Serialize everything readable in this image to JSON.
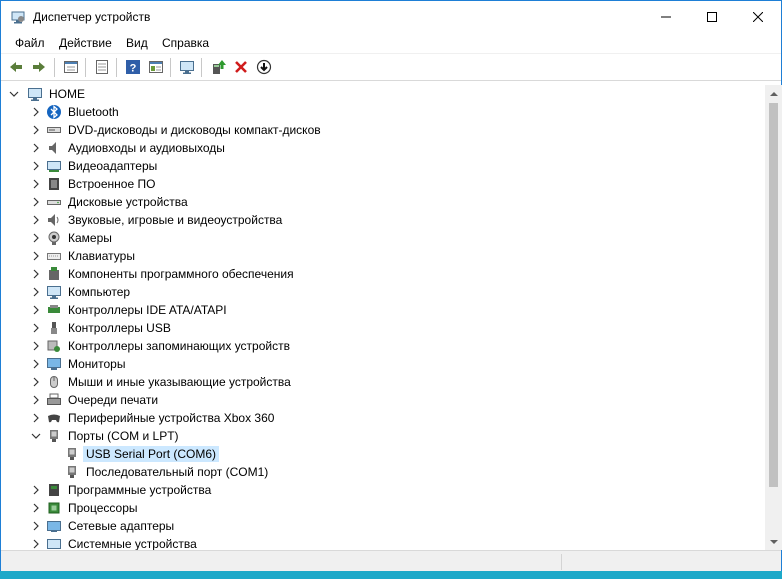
{
  "window": {
    "title": "Диспетчер устройств",
    "accent": "#1e7fd6"
  },
  "menu": {
    "items": [
      "Файл",
      "Действие",
      "Вид",
      "Справка"
    ]
  },
  "toolbar": {
    "buttons": [
      "back-icon",
      "forward-icon",
      "properties-icon",
      "properties-2-icon",
      "help-icon",
      "view-icon",
      "monitor-icon",
      "update-driver-icon",
      "uninstall-icon",
      "download-icon"
    ]
  },
  "tree": {
    "root": "HOME",
    "items": [
      {
        "label": "Bluetooth",
        "icon": "bluetooth-icon",
        "expanded": false
      },
      {
        "label": "DVD-дисководы и дисководы компакт-дисков",
        "icon": "dvd-icon",
        "expanded": false
      },
      {
        "label": "Аудиовходы и аудиовыходы",
        "icon": "audio-icon",
        "expanded": false
      },
      {
        "label": "Видеоадаптеры",
        "icon": "display-adapter-icon",
        "expanded": false
      },
      {
        "label": "Встроенное ПО",
        "icon": "firmware-icon",
        "expanded": false
      },
      {
        "label": "Дисковые устройства",
        "icon": "disk-icon",
        "expanded": false
      },
      {
        "label": "Звуковые, игровые и видеоустройства",
        "icon": "sound-icon",
        "expanded": false
      },
      {
        "label": "Камеры",
        "icon": "camera-icon",
        "expanded": false
      },
      {
        "label": "Клавиатуры",
        "icon": "keyboard-icon",
        "expanded": false
      },
      {
        "label": "Компоненты программного обеспечения",
        "icon": "software-component-icon",
        "expanded": false
      },
      {
        "label": "Компьютер",
        "icon": "computer-icon",
        "expanded": false
      },
      {
        "label": "Контроллеры IDE ATA/ATAPI",
        "icon": "ide-icon",
        "expanded": false
      },
      {
        "label": "Контроллеры USB",
        "icon": "usb-icon",
        "expanded": false
      },
      {
        "label": "Контроллеры запоминающих устройств",
        "icon": "storage-controller-icon",
        "expanded": false
      },
      {
        "label": "Мониторы",
        "icon": "monitor-icon",
        "expanded": false
      },
      {
        "label": "Мыши и иные указывающие устройства",
        "icon": "mouse-icon",
        "expanded": false
      },
      {
        "label": "Очереди печати",
        "icon": "printer-icon",
        "expanded": false
      },
      {
        "label": "Периферийные устройства Xbox 360",
        "icon": "gamepad-icon",
        "expanded": false
      },
      {
        "label": "Порты (COM и LPT)",
        "icon": "port-icon",
        "expanded": true
      },
      {
        "label": "USB Serial Port (COM6)",
        "icon": "port-icon",
        "child": true,
        "selected": true
      },
      {
        "label": "Последовательный порт (COM1)",
        "icon": "port-icon",
        "child": true
      },
      {
        "label": "Программные устройства",
        "icon": "software-device-icon",
        "expanded": false
      },
      {
        "label": "Процессоры",
        "icon": "cpu-icon",
        "expanded": false
      },
      {
        "label": "Сетевые адаптеры",
        "icon": "network-icon",
        "expanded": false
      },
      {
        "label": "Системные устройства",
        "icon": "system-icon",
        "expanded": false
      }
    ]
  }
}
